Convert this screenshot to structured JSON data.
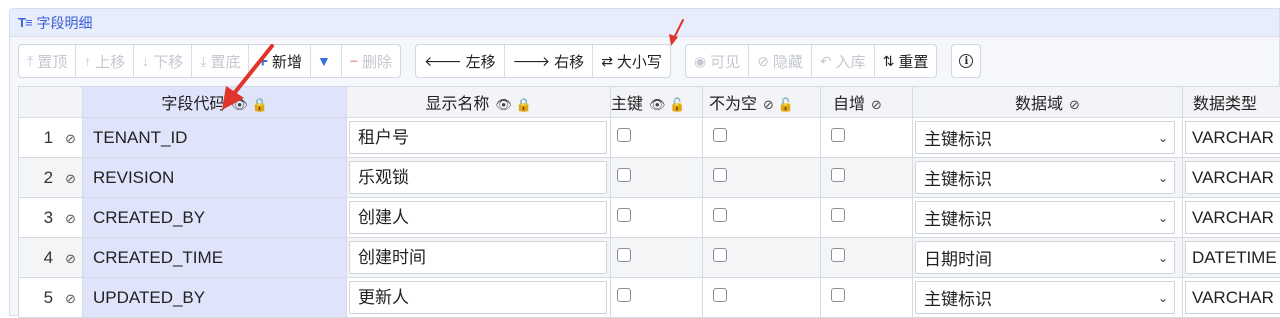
{
  "panel": {
    "title": "字段明细",
    "title_icon": "T≡"
  },
  "toolbar": {
    "group1": [
      {
        "label": "置顶",
        "icon": "⤒",
        "enabled": false
      },
      {
        "label": "上移",
        "icon": "↑",
        "enabled": false
      },
      {
        "label": "下移",
        "icon": "↓",
        "enabled": false
      },
      {
        "label": "置底",
        "icon": "⤓",
        "enabled": false
      },
      {
        "label": "新增",
        "icon": "+",
        "enabled": true
      },
      {
        "label": "",
        "icon": "▼",
        "enabled": true
      },
      {
        "label": "删除",
        "icon": "−",
        "enabled": false
      }
    ],
    "group2": [
      {
        "label": "左移",
        "icon": "🡐",
        "enabled": true
      },
      {
        "label": "右移",
        "icon": "🡒",
        "enabled": true
      },
      {
        "label": "大小写",
        "icon": "⇄",
        "enabled": true
      }
    ],
    "group3": [
      {
        "label": "可见",
        "icon": "◉",
        "enabled": false
      },
      {
        "label": "隐藏",
        "icon": "⊘",
        "enabled": false
      },
      {
        "label": "入库",
        "icon": "↶",
        "enabled": false
      },
      {
        "label": "重置",
        "icon": "⇅",
        "enabled": true
      }
    ],
    "info_icon": "i"
  },
  "table": {
    "headers": {
      "code": "字段代码",
      "name": "显示名称",
      "pk": "主键",
      "notnull": "不为空",
      "autoinc": "自增",
      "domain": "数据域",
      "type": "数据类型"
    },
    "rows": [
      {
        "num": "1",
        "code": "TENANT_ID",
        "name": "租户号",
        "domain": "主键标识",
        "type": "VARCHAR"
      },
      {
        "num": "2",
        "code": "REVISION",
        "name": "乐观锁",
        "domain": "主键标识",
        "type": "VARCHAR"
      },
      {
        "num": "3",
        "code": "CREATED_BY",
        "name": "创建人",
        "domain": "主键标识",
        "type": "VARCHAR"
      },
      {
        "num": "4",
        "code": "CREATED_TIME",
        "name": "创建时间",
        "domain": "日期时间",
        "type": "DATETIME"
      },
      {
        "num": "5",
        "code": "UPDATED_BY",
        "name": "更新人",
        "domain": "主键标识",
        "type": "VARCHAR"
      }
    ]
  },
  "colors": {
    "accent": "#3b5fd6",
    "annotation_arrow": "#e0352b",
    "code_column": "#dfe4fb"
  }
}
